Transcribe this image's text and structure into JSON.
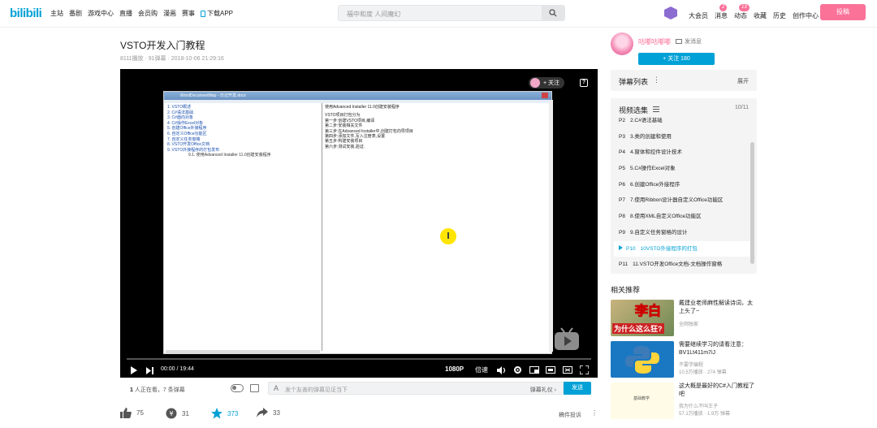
{
  "header": {
    "logo": "bilibili",
    "nav": [
      "主站",
      "番剧",
      "游戏中心",
      "直播",
      "会员购",
      "漫画",
      "赛事"
    ],
    "download": "下载APP",
    "search_placeholder": "福中和度 人间魔幻",
    "right_nav": {
      "vip": "大会员",
      "messages": "消息",
      "messages_badge": "2",
      "dynamic": "动态",
      "dynamic_badge": "13",
      "favorites": "收藏",
      "history": "历史",
      "creator": "创作中心"
    },
    "upload": "投稿"
  },
  "video": {
    "title": "VSTO开发入门教程",
    "meta": "8111播放 · 91弹幕 · 2018-10-06 21:29:16"
  },
  "player": {
    "follow_label": "+ 关注",
    "help": "?",
    "window_title": "WordDocumentMap - 日记开发.docx",
    "tree": [
      "1. VSTO概述",
      "2. C#语法基础",
      "3. C#面向对象",
      "4. C#操作Excel对象",
      "5. 创建Office外接程序",
      "6. 自定义Office功能区",
      "7. 自定义任务窗格",
      "8. VSTO开发Office文档",
      "9. VSTO外接程序的打包发布"
    ],
    "tree_sub": "9.1. 使用Advanced Installer 11.0创建安装程序",
    "doc_heading": "使用Advanced Installer 11.0创建安装程序",
    "doc_lines": [
      "VSTO项目打包分为",
      "第一步:创建VSTO项目,编译",
      "第二步:安装相关文件",
      "第三步:在Advanced Installer中,创建打包向导项目",
      "第四步:添加文件,写入注册表,设置",
      "第五步:构建安装项目",
      "第六步:测试安装,验证."
    ],
    "cursor_label": "I",
    "time": "00:00 / 19:44",
    "quality": "1080P",
    "speed": "倍速"
  },
  "danmaku_bar": {
    "watching_count": "1",
    "watching": "人正在看，7 条弹幕",
    "input_icon": "A",
    "placeholder": "发个友善的弹幕见证当下",
    "etiquette": "弹幕礼仪 ›",
    "send": "发送"
  },
  "actions": {
    "likes": "75",
    "coins": "31",
    "favorites": "373",
    "shares": "33",
    "report": "稿件投诉",
    "more": "⋮"
  },
  "uploader": {
    "name": "咕嘟咕嘟嘟",
    "message": "发消息",
    "follow": "+ 关注 180"
  },
  "danmaku_list": {
    "title": "弹幕列表",
    "dots": "⋮",
    "expand": "展开"
  },
  "playlist": {
    "title": "视频选集",
    "count": "10/11",
    "active_index": 8,
    "items": [
      {
        "p": "P2",
        "t": "2.C#语法基础"
      },
      {
        "p": "P3",
        "t": "3.类的创建和使用"
      },
      {
        "p": "P4",
        "t": "4.窗体和控件设计技术"
      },
      {
        "p": "P5",
        "t": "5.C#操作Excel对象"
      },
      {
        "p": "P6",
        "t": "6.创建Office外接程序"
      },
      {
        "p": "P7",
        "t": "7.使用Ribbon设计器自定义Office功能区"
      },
      {
        "p": "P8",
        "t": "8.使用XML自定义Office功能区"
      },
      {
        "p": "P9",
        "t": "9.自定义任务窗格的设计"
      },
      {
        "p": "P10",
        "t": "10VSTO外接程序的打包"
      },
      {
        "p": "P11",
        "t": "11.VSTO开发Office文档-文档操作窗格"
      }
    ]
  },
  "related": {
    "title": "相关推荐",
    "items": [
      {
        "title": "戴建业老师麻性解读诗词，太上头了~",
        "up": "全网独家",
        "stats": "",
        "thumb_big": "李白",
        "thumb_small": "为什么这么狂?"
      },
      {
        "title": "需要继续学习的请看注意：BV1Lt411m7iJ",
        "up": "不要学编程",
        "stats": "10.5万播放 · 274 弹幕",
        "thumb_big": "",
        "thumb_small": ""
      },
      {
        "title": "这大概是最好的C#入门教程了吧",
        "up": "我为什么不叫王子",
        "stats": "57.1万播放 · 1.9万 弹幕",
        "thumb_big": "",
        "thumb_small": "基础教学"
      }
    ]
  },
  "colors": {
    "brand_blue": "#00a1d6",
    "brand_pink": "#fb7299"
  }
}
